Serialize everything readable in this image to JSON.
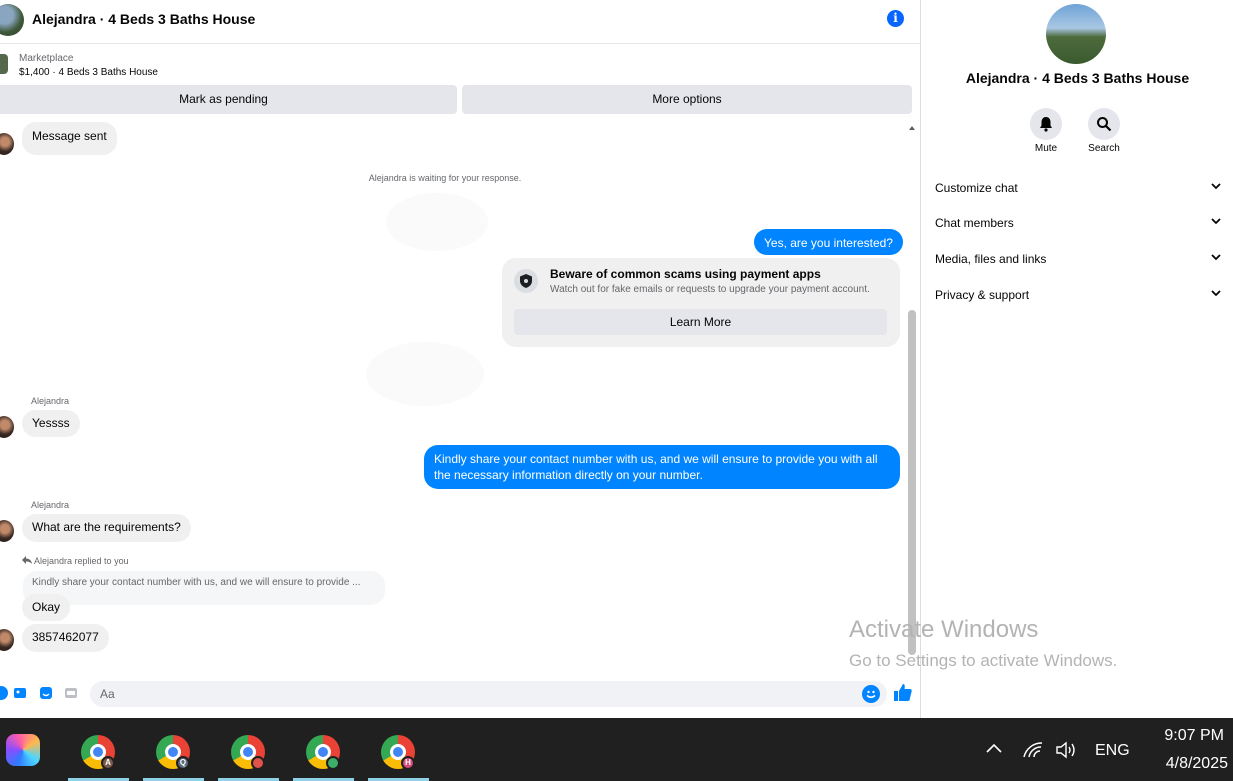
{
  "header": {
    "title": "Alejandra · 4 Beds 3 Baths House"
  },
  "listing": {
    "source": "Marketplace",
    "price_title": "$1,400 · 4 Beds 3 Baths House"
  },
  "actions": {
    "pending": "Mark as pending",
    "more": "More options"
  },
  "messages": {
    "sent_status": "Message sent",
    "waiting_note": "Alejandra is waiting for your response.",
    "out1": "Yes, are you interested?",
    "scam_title": "Beware of common scams using payment apps",
    "scam_desc": "Watch out for fake emails or requests to upgrade your payment account.",
    "learn_more": "Learn More",
    "sender1": "Alejandra",
    "in1": "Yessss",
    "out2": "Kindly share your contact number with us, and we will ensure to provide you with all the necessary information directly on your number.",
    "sender2": "Alejandra",
    "in2": "What are the requirements?",
    "reply_label": "Alejandra replied to you",
    "reply_quote": "Kindly share your contact number with us, and we will ensure to provide ...",
    "in3": "Okay",
    "in4": "3857462077"
  },
  "composer": {
    "placeholder": "Aa"
  },
  "side": {
    "title": "Alejandra · 4 Beds 3 Baths House",
    "mute": "Mute",
    "search": "Search",
    "sections": [
      "Customize chat",
      "Chat members",
      "Media, files and links",
      "Privacy & support"
    ]
  },
  "watermark": {
    "line1": "Activate Windows",
    "line2": "Go to Settings to activate Windows."
  },
  "taskbar": {
    "apps": [
      {
        "icon": "chrome-icon",
        "badge": "A",
        "badge_color": "#7a5a4a"
      },
      {
        "icon": "chrome-icon",
        "badge": "Q",
        "badge_color": "#5a6a7a"
      },
      {
        "icon": "chrome-icon",
        "badge": "",
        "badge_color": "#e0524a"
      },
      {
        "icon": "chrome-icon",
        "badge": "",
        "badge_color": "#3fae6a"
      },
      {
        "icon": "chrome-icon",
        "badge": "H",
        "badge_color": "#d94a7a"
      }
    ],
    "lang": "ENG",
    "time": "9:07 PM",
    "date": "4/8/2025"
  },
  "colors": {
    "accent": "#0084ff",
    "info": "#0866ff",
    "bubble_in": "#f0f0f0",
    "taskbar": "#202020"
  }
}
